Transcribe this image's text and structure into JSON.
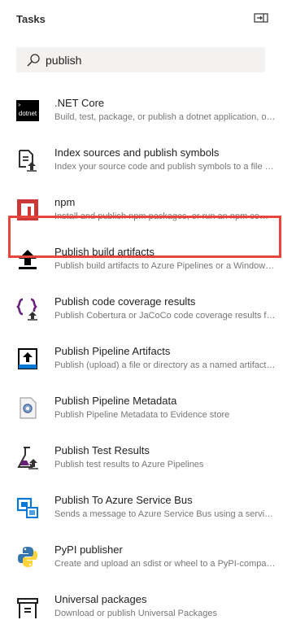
{
  "panel": {
    "title": "Tasks",
    "collapse_icon": "collapse-panel-icon"
  },
  "search": {
    "value": "publish",
    "icon": "search-icon"
  },
  "tasks": [
    {
      "name": ".NET Core",
      "description": "Build, test, package, or publish a dotnet application, or run a custom dotnet command",
      "icon": "dotnet-icon",
      "icon_text": "dotnet"
    },
    {
      "name": "Index sources and publish symbols",
      "description": "Index your source code and publish symbols to a file share or Azure Artifacts symbol server",
      "icon": "index-symbols-icon"
    },
    {
      "name": "npm",
      "description": "Install and publish npm packages, or run an npm command",
      "icon": "npm-icon"
    },
    {
      "name": "Publish build artifacts",
      "description": "Publish build artifacts to Azure Pipelines or a Windows file share",
      "icon": "upload-arrow-icon"
    },
    {
      "name": "Publish code coverage results",
      "description": "Publish Cobertura or JaCoCo code coverage results from a build",
      "icon": "code-coverage-icon"
    },
    {
      "name": "Publish Pipeline Artifacts",
      "description": "Publish (upload) a file or directory as a named artifact for the current run",
      "icon": "pipeline-artifacts-icon"
    },
    {
      "name": "Publish Pipeline Metadata",
      "description": "Publish Pipeline Metadata to Evidence store",
      "icon": "pipeline-metadata-icon"
    },
    {
      "name": "Publish Test Results",
      "description": "Publish test results to Azure Pipelines",
      "icon": "test-results-icon"
    },
    {
      "name": "Publish To Azure Service Bus",
      "description": "Sends a message to Azure Service Bus using a service connection",
      "icon": "service-bus-icon"
    },
    {
      "name": "PyPI publisher",
      "description": "Create and upload an sdist or wheel to a PyPI-compatible index",
      "icon": "python-icon"
    },
    {
      "name": "Universal packages",
      "description": "Download or publish Universal Packages",
      "icon": "universal-packages-icon"
    }
  ],
  "colors": {
    "highlight": "#e8463d",
    "npm": "#cb3837",
    "coverage": "#68217a",
    "azure": "#0078d4"
  }
}
